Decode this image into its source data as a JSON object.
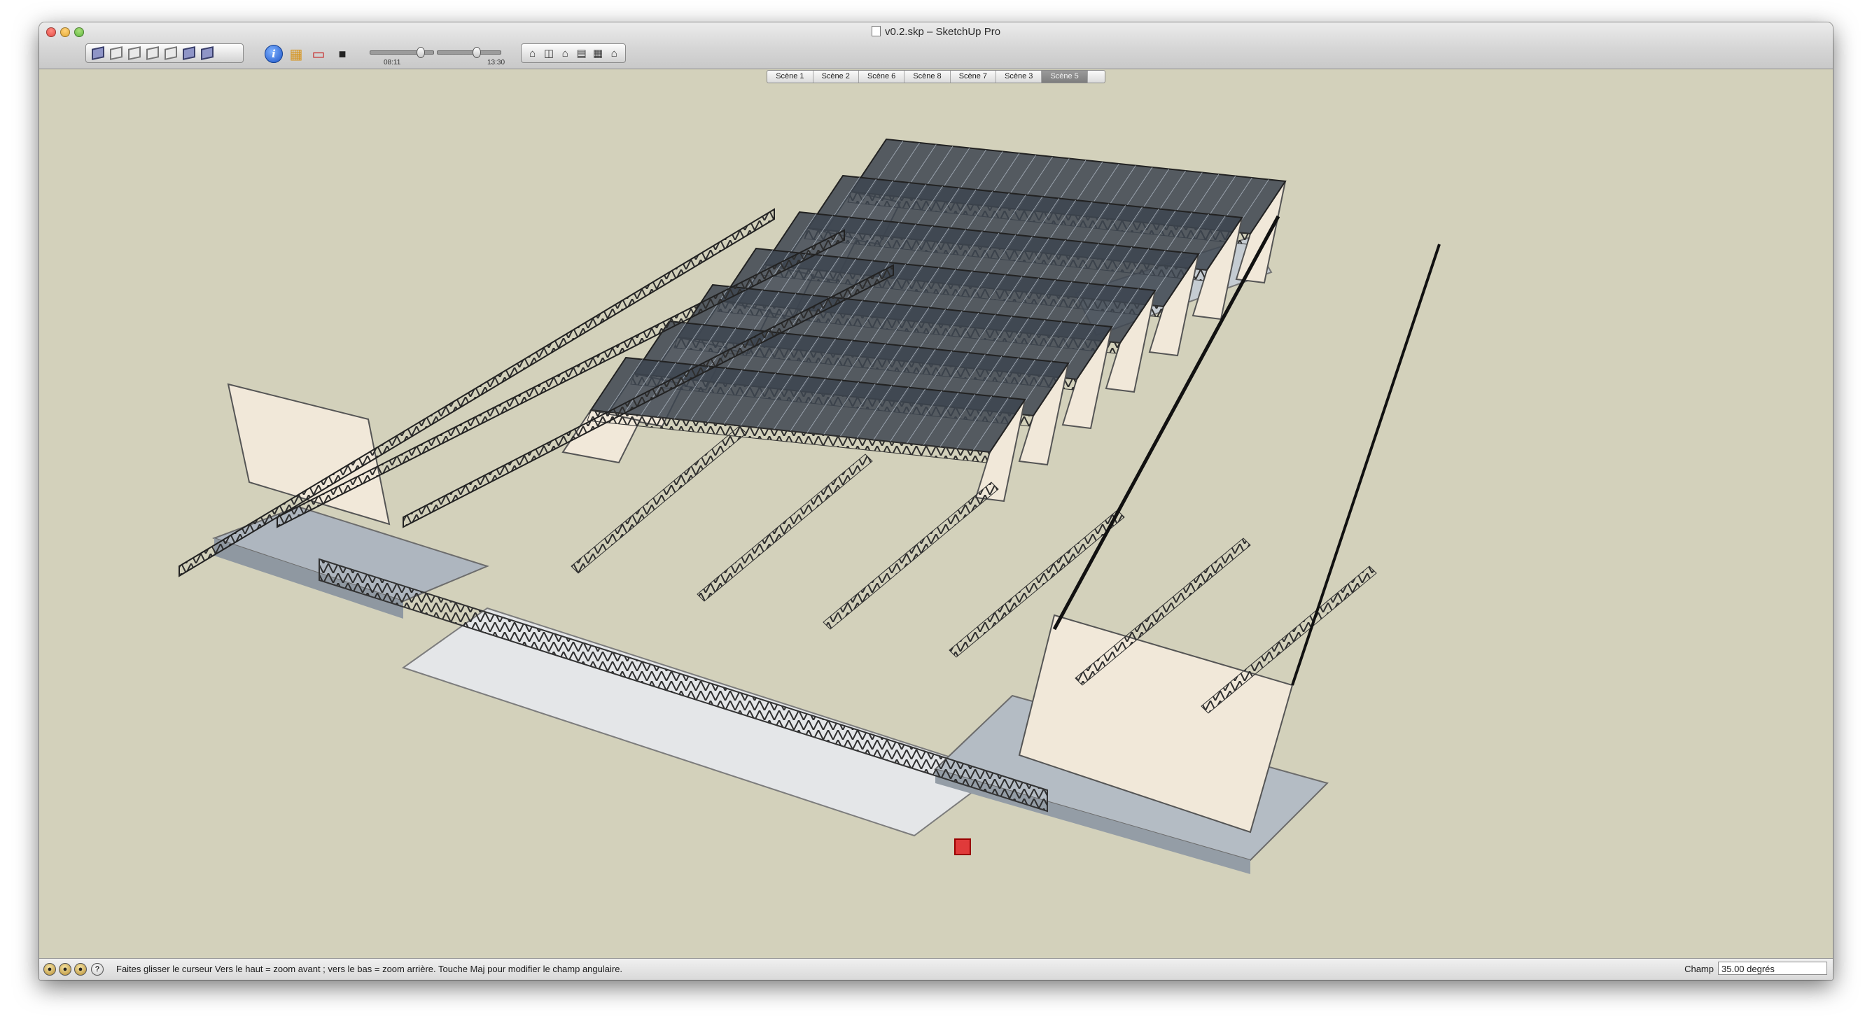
{
  "window": {
    "title": "v0.2.skp – SketchUp Pro"
  },
  "toolbar": {
    "view_buttons": [
      "iso-view-icon",
      "top-view-icon",
      "front-view-icon",
      "right-view-icon",
      "back-view-icon",
      "left-view-icon",
      "bottom-view-icon"
    ],
    "shadow_times": {
      "start": "08:11",
      "end": "13:30"
    }
  },
  "scenes": {
    "tabs": [
      "Scène 1",
      "Scène 2",
      "Scène 6",
      "Scène 8",
      "Scène 7",
      "Scène 3",
      "Scène 5"
    ],
    "active": "Scène 5"
  },
  "status": {
    "message": "Faites glisser le curseur  Vers le haut = zoom avant ; vers le bas = zoom arrière. Touche Maj pour modifier le champ angulaire.",
    "measure_label": "Champ",
    "measure_value": "35.00 degrés"
  },
  "colors": {
    "background": "#d3d1bb",
    "wall": "#f1e8d9",
    "glass": "#3d4550",
    "slab": "#b6bdc4",
    "truss": "#3a3a3a",
    "accent_red": "#e03a3a"
  }
}
